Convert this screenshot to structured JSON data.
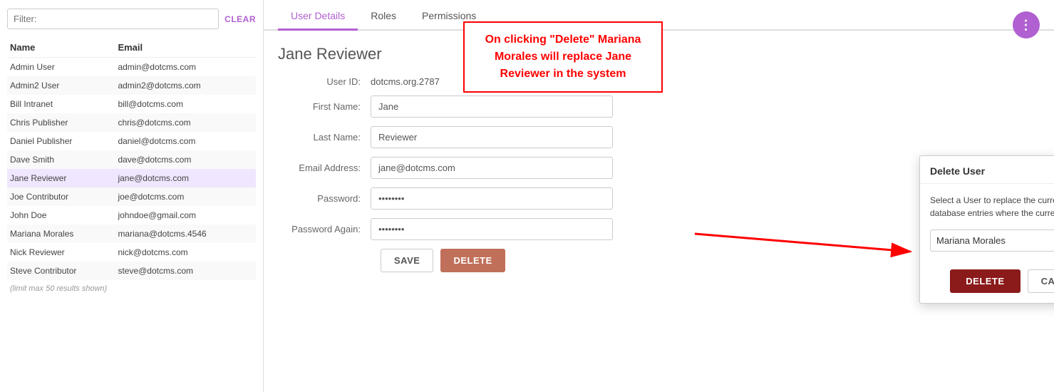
{
  "left_panel": {
    "filter_placeholder": "Filter:",
    "clear_label": "CLEAR",
    "table": {
      "headers": [
        "Name",
        "Email"
      ],
      "rows": [
        {
          "name": "Admin User",
          "email": "admin@dotcms.com",
          "active": false
        },
        {
          "name": "Admin2 User",
          "email": "admin2@dotcms.com",
          "active": false
        },
        {
          "name": "Bill Intranet",
          "email": "bill@dotcms.com",
          "active": false
        },
        {
          "name": "Chris Publisher",
          "email": "chris@dotcms.com",
          "active": false
        },
        {
          "name": "Daniel Publisher",
          "email": "daniel@dotcms.com",
          "active": false
        },
        {
          "name": "Dave Smith",
          "email": "dave@dotcms.com",
          "active": false
        },
        {
          "name": "Jane Reviewer",
          "email": "jane@dotcms.com",
          "active": true
        },
        {
          "name": "Joe Contributor",
          "email": "joe@dotcms.com",
          "active": false
        },
        {
          "name": "John Doe",
          "email": "johndoe@gmail.com",
          "active": false
        },
        {
          "name": "Mariana Morales",
          "email": "mariana@dotcms.4546",
          "active": false
        },
        {
          "name": "Nick Reviewer",
          "email": "nick@dotcms.com",
          "active": false
        },
        {
          "name": "Steve Contributor",
          "email": "steve@dotcms.com",
          "active": false
        }
      ],
      "limit_note": "(limit max 50 results shown)"
    }
  },
  "tabs": [
    {
      "label": "User Details",
      "active": true
    },
    {
      "label": "Roles",
      "active": false
    },
    {
      "label": "Permissions",
      "active": false
    }
  ],
  "form": {
    "title": "Jane Reviewer",
    "user_id_label": "User ID:",
    "user_id_value": "dotcms.org.2787",
    "first_name_label": "First Name:",
    "first_name_value": "Jane",
    "last_name_label": "Last Name:",
    "last_name_value": "Reviewer",
    "email_label": "Email Address:",
    "email_value": "jane@dotcms.com",
    "password_label": "Password:",
    "password_value": "••••••••",
    "password_again_label": "Password Again:",
    "password_again_value": "••••••••",
    "save_label": "SAVE",
    "delete_label": "DELETE"
  },
  "annotation": {
    "text": "On clicking \"Delete\" Mariana Morales will replace Jane Reviewer in the system"
  },
  "modal": {
    "title": "Delete User",
    "description": "Select a User to replace the current user (in all database entries where the current user exists):",
    "selected_user": "Mariana Morales",
    "delete_label": "DELETE",
    "cancel_label": "CANCEL",
    "close_label": "×"
  },
  "more_icon": "⋮"
}
